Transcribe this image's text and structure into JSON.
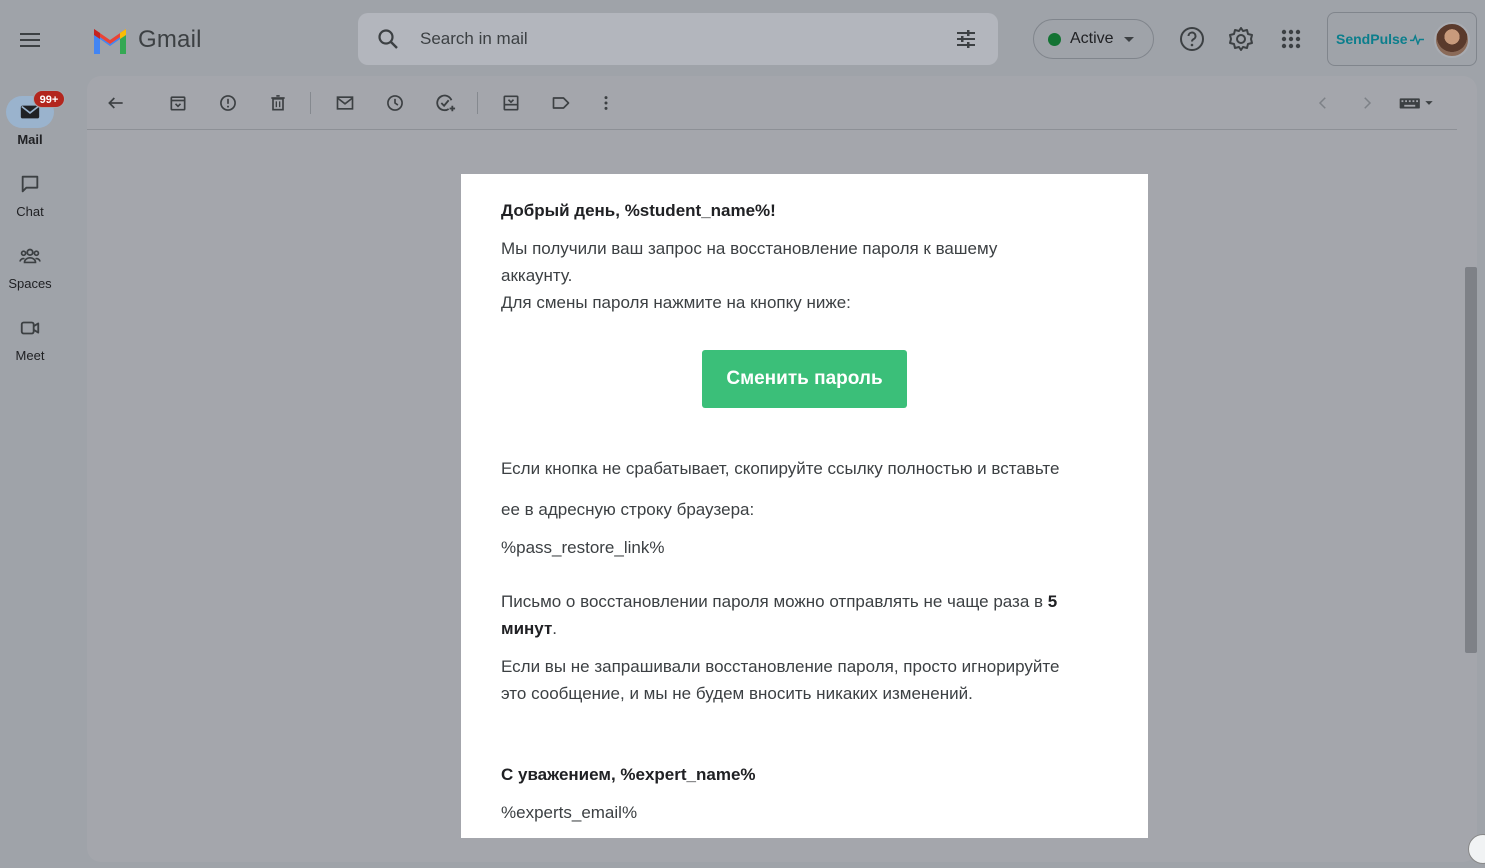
{
  "app": {
    "name": "Gmail"
  },
  "search": {
    "placeholder": "Search in mail"
  },
  "status": {
    "label": "Active",
    "color": "#137333"
  },
  "account": {
    "brand": "SendPulse"
  },
  "rail": {
    "items": [
      {
        "label": "Mail",
        "badge": "99+",
        "icon": "mail-icon"
      },
      {
        "label": "Chat",
        "icon": "chat-icon"
      },
      {
        "label": "Spaces",
        "icon": "spaces-icon"
      },
      {
        "label": "Meet",
        "icon": "meet-icon"
      }
    ]
  },
  "toolbar": {
    "icons": [
      "back-arrow-icon",
      "archive-icon",
      "report-spam-icon",
      "delete-icon",
      "mark-unread-icon",
      "snooze-icon",
      "add-task-icon",
      "move-to-icon",
      "label-icon",
      "more-icon",
      "prev-icon",
      "next-icon",
      "input-tools-icon"
    ]
  },
  "email": {
    "greeting": "Добрый день, %student_name%!",
    "intro_line1": "Мы получили ваш запрос на восстановление пароля к вашему",
    "intro_line2": "аккаунту.",
    "intro_line3": "Для смены пароля нажмите на кнопку ниже:",
    "button": "Сменить пароль",
    "fallback_line1": "Если кнопка не срабатывает, скопируйте ссылку полностью и вставьте",
    "fallback_line2": "ее в адресную строку браузера:",
    "link": "%pass_restore_link%",
    "limit_prefix": "Письмо о восстановлении пароля можно отправлять не чаще раза в ",
    "limit_bold_1": "5",
    "limit_bold_2": "минут",
    "limit_suffix": ".",
    "ignore_line1": "Если вы не запрашивали восстановление пароля, просто игнорируйте",
    "ignore_line2": "это сообщение, и мы не будем вносить никаких изменений.",
    "signoff": "С уважением, %expert_name%",
    "email": "%experts_email%"
  },
  "colors": {
    "cta": "#3bbf79",
    "badge": "#b3261e",
    "brand": "#0b7e8c"
  }
}
